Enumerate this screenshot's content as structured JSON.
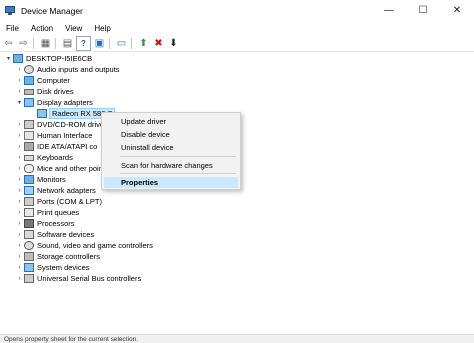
{
  "window": {
    "title": "Device Manager",
    "minimize": "—",
    "maximize": "☐",
    "close": "✕"
  },
  "menu": [
    "File",
    "Action",
    "View",
    "Help"
  ],
  "toolbar": {
    "back": "⇦",
    "forward": "⇨",
    "show_hidden": "▦",
    "properties": "▤",
    "help": "?",
    "view": "▣",
    "monitor": "▭",
    "update_driver": "⬆",
    "uninstall": "✖",
    "download": "⬇"
  },
  "tree": {
    "root": "DESKTOP-I5IE6CB",
    "items": [
      "Audio inputs and outputs",
      "Computer",
      "Disk drives",
      "Display adapters",
      "Radeon RX 580 S",
      "DVD/CD-ROM drive",
      "Human Interface",
      "IDE ATA/ATAPI co",
      "Keyboards",
      "Mice and other poin",
      "Monitors",
      "Network adapters",
      "Ports (COM & LPT)",
      "Print queues",
      "Processors",
      "Software devices",
      "Sound, video and game controllers",
      "Storage controllers",
      "System devices",
      "Universal Serial Bus controllers"
    ]
  },
  "context_menu": {
    "update": "Update driver",
    "disable": "Disable device",
    "uninstall": "Uninstall device",
    "scan": "Scan for hardware changes",
    "properties": "Properties"
  },
  "status": "Opens property sheet for the current selection.",
  "colors": {
    "selection": "#cce8ff",
    "accent": "#3a7fc4"
  }
}
